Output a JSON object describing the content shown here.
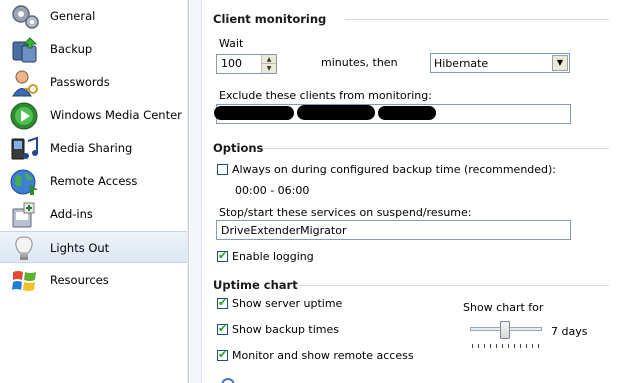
{
  "sidebar": {
    "items": [
      {
        "label": "General",
        "icon": "gear-icon",
        "selected": false
      },
      {
        "label": "Backup",
        "icon": "backup-icon",
        "selected": false
      },
      {
        "label": "Passwords",
        "icon": "user-key-icon",
        "selected": false
      },
      {
        "label": "Windows Media Center",
        "icon": "media-center-icon",
        "selected": false
      },
      {
        "label": "Media Sharing",
        "icon": "music-notes-icon",
        "selected": false
      },
      {
        "label": "Remote Access",
        "icon": "globe-icon",
        "selected": false
      },
      {
        "label": "Add-ins",
        "icon": "add-in-icon",
        "selected": false
      },
      {
        "label": "Lights Out",
        "icon": "lightbulb-icon",
        "selected": true
      },
      {
        "label": "Resources",
        "icon": "windows-flag-icon",
        "selected": false
      }
    ]
  },
  "client_monitoring": {
    "heading": "Client monitoring",
    "wait_label": "Wait",
    "wait_value": "100",
    "minutes_label": "minutes, then",
    "action_value": "Hibernate",
    "exclude_label": "Exclude these clients from monitoring:",
    "exclude_value_visible": ", ,"
  },
  "options": {
    "heading": "Options",
    "always_on_label": "Always on during configured backup time (recommended):",
    "always_on_checked": false,
    "backup_time": "00:00 - 06:00",
    "services_label": "Stop/start these services on suspend/resume:",
    "services_value": "DriveExtenderMigrator",
    "logging_label": "Enable logging",
    "logging_checked": true
  },
  "uptime_chart": {
    "heading": "Uptime chart",
    "show_uptime_label": "Show server uptime",
    "show_uptime_checked": true,
    "show_backup_label": "Show backup times",
    "show_backup_checked": true,
    "remote_access_label": "Monitor and show remote access",
    "remote_access_checked": true,
    "show_chart_for_label": "Show chart for",
    "chart_days_value": "7 days",
    "slider_fraction": 0.45
  },
  "colors": {
    "selection_bg": "#dde7f4",
    "check_green": "#21a121",
    "section_line": "#d6dde8"
  }
}
